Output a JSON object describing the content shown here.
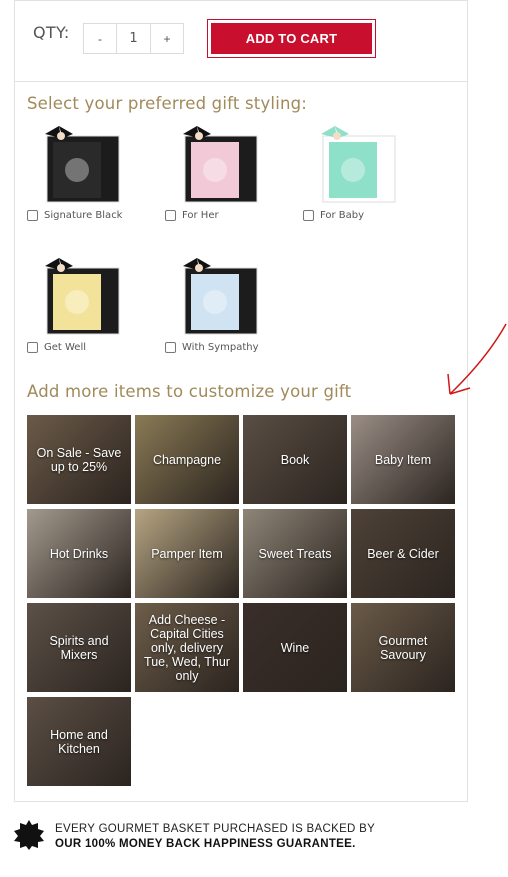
{
  "purchase": {
    "qty_label": "QTY:",
    "decrement_label": "-",
    "quantity": "1",
    "increment_label": "+",
    "add_to_cart_label": "ADD TO CART",
    "accent_color": "#c8102e"
  },
  "gift_styling": {
    "title": "Select your preferred gift styling:",
    "options": [
      {
        "label": "Signature Black",
        "box_color": "#1c1c1c",
        "card_color": "#2a2a2a"
      },
      {
        "label": "For Her",
        "box_color": "#1c1c1c",
        "card_color": "#f2c9d6"
      },
      {
        "label": "For Baby",
        "box_color": "#ffffff",
        "card_color": "#8fe0c8"
      },
      {
        "label": "Get Well",
        "box_color": "#1c1c1c",
        "card_color": "#f3e39a"
      },
      {
        "label": "With Sympathy",
        "box_color": "#1c1c1c",
        "card_color": "#cfe3f2"
      }
    ]
  },
  "customize": {
    "title": "Add more items to customize your gift",
    "items": [
      {
        "label": "On Sale - Save up to 25%",
        "tone": "#6b5a48"
      },
      {
        "label": "Champagne",
        "tone": "#8a7a55"
      },
      {
        "label": "Book",
        "tone": "#5a4e44"
      },
      {
        "label": "Baby Item",
        "tone": "#9a8e86"
      },
      {
        "label": "Hot Drinks",
        "tone": "#a39a8e"
      },
      {
        "label": "Pamper Item",
        "tone": "#b6a583"
      },
      {
        "label": "Sweet Treats",
        "tone": "#8e8678"
      },
      {
        "label": "Beer & Cider",
        "tone": "#4e4238"
      },
      {
        "label": "Spirits and Mixers",
        "tone": "#5c5148"
      },
      {
        "label": "Add Cheese - Capital Cities only, delivery Tue, Wed, Thur only",
        "tone": "#6e5e4a"
      },
      {
        "label": "Wine",
        "tone": "#3a2e2a"
      },
      {
        "label": "Gourmet Savoury",
        "tone": "#6a5a48"
      },
      {
        "label": "Home and Kitchen",
        "tone": "#5b4f45"
      }
    ]
  },
  "guarantee": {
    "line1": "EVERY GOURMET BASKET PURCHASED IS BACKED BY",
    "line2": "OUR 100% MONEY BACK HAPPINESS GUARANTEE."
  },
  "icons": {
    "seal": "badge-seal-icon",
    "ribbon": "ribbon-bow-icon",
    "annotation": "red-arrow-annotation"
  }
}
